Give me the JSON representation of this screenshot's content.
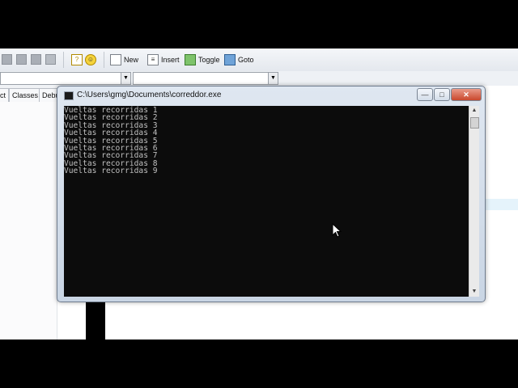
{
  "toolbar": {
    "new_label": "New",
    "insert_label": "Insert",
    "toggle_label": "Toggle",
    "goto_label": "Goto"
  },
  "tabs": {
    "tab1": "ct",
    "tab2": "Classes",
    "tab3": "Debu"
  },
  "console": {
    "title": "C:\\Users\\gmg\\Documents\\correddor.exe",
    "output": "Vueltas recorridas 1\nVueltas recorridas 2\nVueltas recorridas 3\nVueltas recorridas 4\nVueltas recorridas 5\nVueltas recorridas 6\nVueltas recorridas 7\nVueltas recorridas 8\nVueltas recorridas 9"
  },
  "window_buttons": {
    "minimize": "—",
    "maximize": "□",
    "close": "✕"
  }
}
